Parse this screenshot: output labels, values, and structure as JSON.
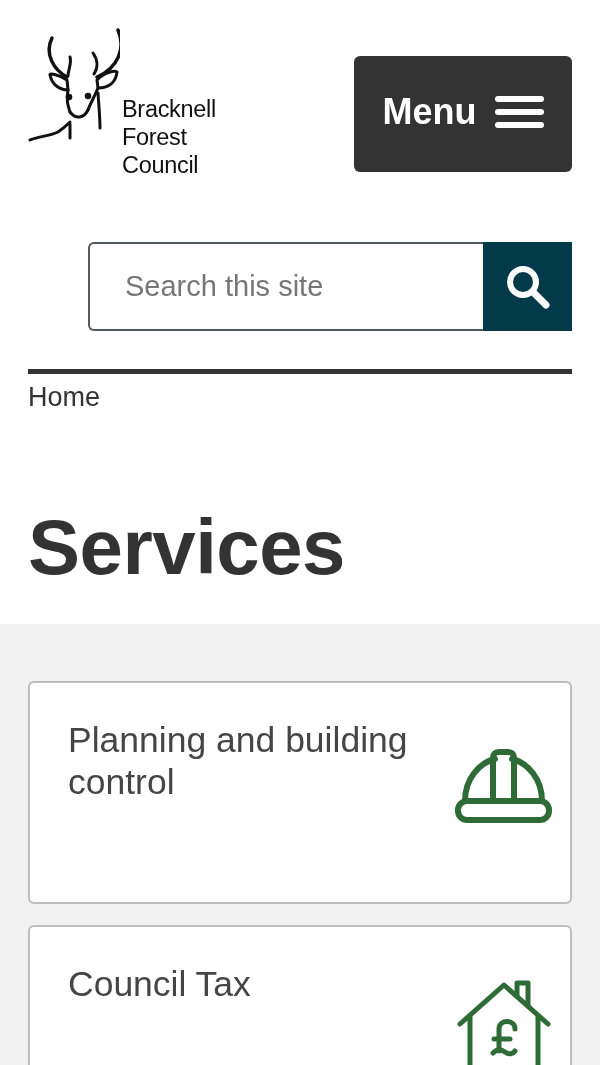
{
  "header": {
    "logo": {
      "lines": [
        "Bracknell",
        "Forest",
        "Council"
      ]
    },
    "menu_button": {
      "label": "Menu"
    }
  },
  "search": {
    "placeholder": "Search this site"
  },
  "breadcrumbs": [
    {
      "label": "Home"
    }
  ],
  "page_title": "Services",
  "services": [
    {
      "title": "Planning and building control",
      "kind": "hard-hat"
    },
    {
      "title": "Council Tax",
      "kind": "house-pound"
    }
  ]
}
